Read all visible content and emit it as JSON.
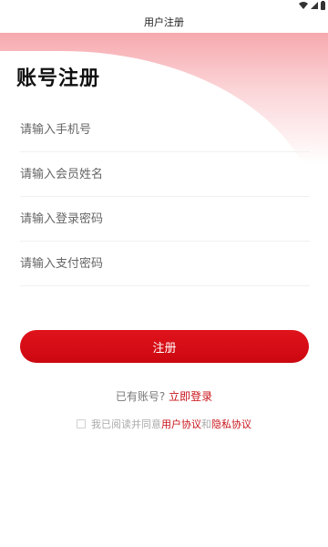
{
  "status_bar": {
    "icons": [
      "wifi-icon",
      "signal-icon",
      "battery-icon"
    ]
  },
  "header": {
    "title": "用户注册"
  },
  "page": {
    "heading": "账号注册",
    "accent_color": "#d00b13"
  },
  "form": {
    "fields": [
      {
        "placeholder": "请输入手机号",
        "value": ""
      },
      {
        "placeholder": "请输入会员姓名",
        "value": ""
      },
      {
        "placeholder": "请输入登录密码",
        "value": ""
      },
      {
        "placeholder": "请输入支付密码",
        "value": ""
      }
    ],
    "submit_label": "注册"
  },
  "login": {
    "prompt": "已有账号?",
    "link": "立即登录"
  },
  "agreement": {
    "checked": false,
    "prefix": "我已阅读并同意",
    "user_agreement": "用户协议",
    "conjunction": "和",
    "privacy_policy": "隐私协议"
  }
}
